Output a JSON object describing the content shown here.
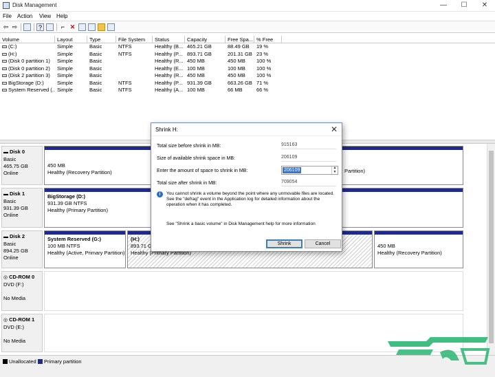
{
  "window": {
    "title": "Disk Management"
  },
  "menu": [
    "File",
    "Action",
    "View",
    "Help"
  ],
  "volume_table": {
    "headers": [
      "Volume",
      "Layout",
      "Type",
      "File System",
      "Status",
      "Capacity",
      "Free Spa...",
      "% Free"
    ],
    "rows": [
      [
        "(C:)",
        "Simple",
        "Basic",
        "NTFS",
        "Healthy (B...",
        "465.21 GB",
        "88.49 GB",
        "19 %"
      ],
      [
        "(H:)",
        "Simple",
        "Basic",
        "NTFS",
        "Healthy (P...",
        "893.71 GB",
        "201.31 GB",
        "23 %"
      ],
      [
        "(Disk 0 partition 1)",
        "Simple",
        "Basic",
        "",
        "Healthy (R...",
        "450 MB",
        "450 MB",
        "100 %"
      ],
      [
        "(Disk 0 partition 2)",
        "Simple",
        "Basic",
        "",
        "Healthy (E...",
        "100 MB",
        "100 MB",
        "100 %"
      ],
      [
        "(Disk 2 partition 3)",
        "Simple",
        "Basic",
        "",
        "Healthy (R...",
        "450 MB",
        "450 MB",
        "100 %"
      ],
      [
        "BigStorage (D:)",
        "Simple",
        "Basic",
        "NTFS",
        "Healthy (P...",
        "931.39 GB",
        "663.26 GB",
        "71 %"
      ],
      [
        "System Reserved (...",
        "Simple",
        "Basic",
        "NTFS",
        "Healthy (A...",
        "100 MB",
        "66 MB",
        "66 %"
      ]
    ]
  },
  "disks": {
    "disk0": {
      "name": "Disk 0",
      "type": "Basic",
      "size": "465.75 GB",
      "status": "Online",
      "p1_size": "450 MB",
      "p1_status": "Healthy (Recovery Partition)",
      "p_right_status": "Partition)"
    },
    "disk1": {
      "name": "Disk 1",
      "type": "Basic",
      "size": "931.39 GB",
      "status": "Online",
      "p1_name": "BigStorage  (D:)",
      "p1_size": "931.39 GB NTFS",
      "p1_status": "Healthy (Primary Partition)"
    },
    "disk2": {
      "name": "Disk 2",
      "type": "Basic",
      "size": "894.25 GB",
      "status": "Online",
      "p1_name": "System Reserved  (G:)",
      "p1_size": "100 MB NTFS",
      "p1_status": "Healthy (Active, Primary Partition)",
      "p2_name": "(H:)",
      "p2_size": "893.71 GE",
      "p2_status": "Healthy (Primary Partition)",
      "p3_size": "450 MB",
      "p3_status": "Healthy (Recovery Partition)"
    },
    "cdrom0": {
      "name": "CD-ROM 0",
      "drive": "DVD (F:)",
      "media": "No Media"
    },
    "cdrom1": {
      "name": "CD-ROM 1",
      "drive": "DVD (E:)",
      "media": "No Media"
    }
  },
  "legend": {
    "unallocated": "Unallocated",
    "primary": "Primary partition"
  },
  "dialog": {
    "title": "Shrink H:",
    "total_before_label": "Total size before shrink in MB:",
    "total_before": "915163",
    "available_label": "Size of available shrink space in MB:",
    "available": "206109",
    "enter_label": "Enter the amount of space to shrink in MB:",
    "enter_value": "206109",
    "after_label": "Total size after shrink in MB:",
    "after": "709054",
    "info": "You cannot shrink a volume beyond the point where any unmovable files are located. See the \"defrag\" event in the Application log for detailed information about the operation when it has completed.",
    "help": "See \"Shrink a basic volume\" in Disk Management help for more information",
    "shrink_button": "Shrink",
    "cancel_button": "Cancel"
  },
  "colors": {
    "primary": "#1f2a8a",
    "watermark": "#2bb673",
    "accent": "#3a76d0"
  }
}
